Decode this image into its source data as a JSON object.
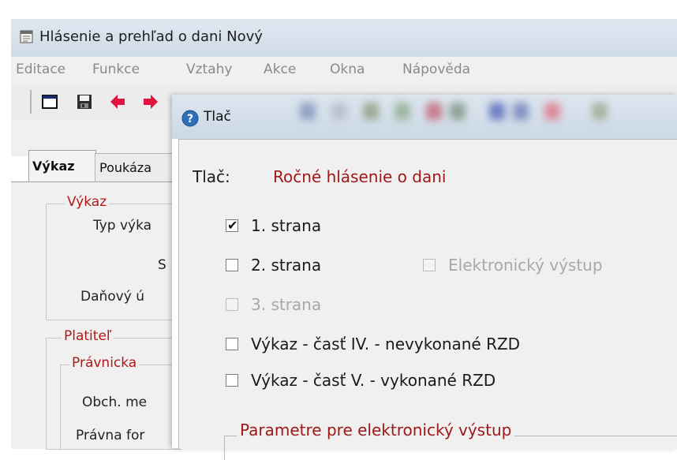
{
  "window": {
    "title": "Hlásenie a prehľad o dani Nový",
    "icon": "document-calendar-icon"
  },
  "menu": [
    "Editace",
    "Funkce",
    "Vztahy",
    "Akce",
    "Okna",
    "Nápověda"
  ],
  "toolbar": {
    "icons": [
      "window-icon",
      "save-icon",
      "arrow-left-icon",
      "arrow-right-icon"
    ],
    "colors": {
      "arrow": "#e0143c"
    }
  },
  "tabs": [
    {
      "label": "Výkaz",
      "active": true
    },
    {
      "label": "Poukáza",
      "active": false
    }
  ],
  "background_form": {
    "group_vykaz": {
      "legend": "Výkaz",
      "fields": [
        "Typ výka",
        "S",
        "Daňový ú"
      ]
    },
    "group_platitel": {
      "legend": "Platiteľ",
      "subgroup_legend": "Právnicka",
      "fields": [
        "Obch. me",
        "Právna for"
      ]
    }
  },
  "dialog": {
    "title": "Tlač",
    "icon": "help-question-icon",
    "print_label": "Tlač:",
    "print_value": "Ročné hlásenie o dani",
    "options": [
      {
        "label": "1. strana",
        "checked": true,
        "enabled": true
      },
      {
        "label": "2. strana",
        "checked": false,
        "enabled": true
      },
      {
        "label": "3. strana",
        "checked": false,
        "enabled": false
      },
      {
        "label": "Výkaz - časť IV. - nevykonané RZD",
        "checked": false,
        "enabled": true
      },
      {
        "label": "Výkaz - časť V. - vykonané RZD",
        "checked": false,
        "enabled": true
      }
    ],
    "electronic_output": {
      "label": "Elektronický výstup",
      "checked": false,
      "enabled": false
    },
    "param_group_legend": "Parametre pre elektronický výstup",
    "colors": {
      "accent_text": "#a01818"
    }
  }
}
